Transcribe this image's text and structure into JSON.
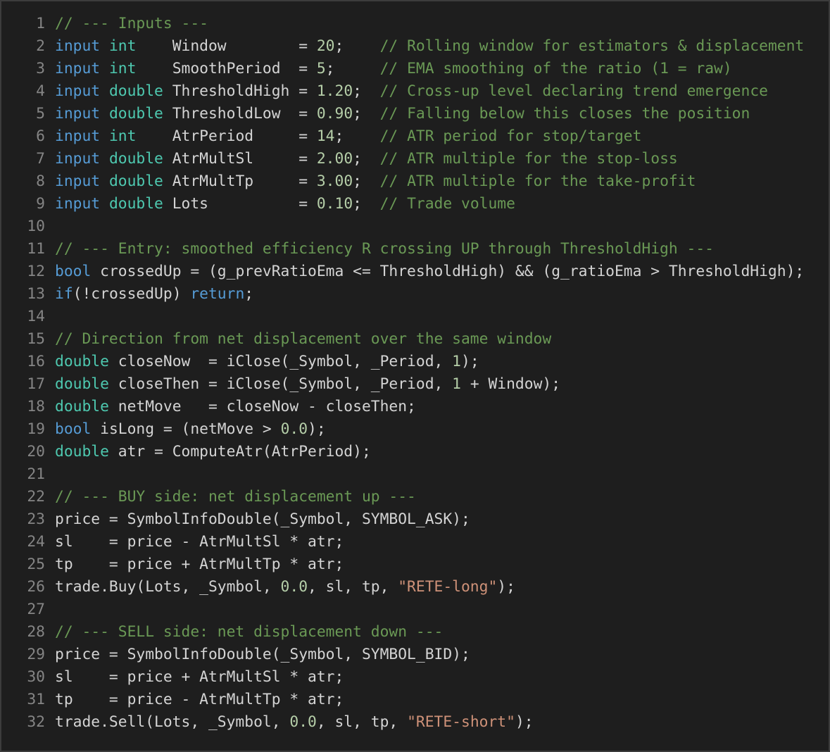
{
  "colors": {
    "background": "#1e1e1e",
    "border": "#3c3c3c",
    "line_number": "#858585",
    "plain": "#d4d4d4",
    "comment": "#6a9955",
    "keyword": "#569cd6",
    "type": "#4ec9b0",
    "number": "#b5cea8",
    "string": "#ce9178"
  },
  "editor": {
    "lines": [
      {
        "n": "1",
        "tokens": [
          {
            "t": "comment",
            "v": "// --- Inputs ---"
          }
        ]
      },
      {
        "n": "2",
        "tokens": [
          {
            "t": "keyword",
            "v": "input"
          },
          {
            "t": "plain",
            "v": " "
          },
          {
            "t": "type",
            "v": "int"
          },
          {
            "t": "plain",
            "v": "    Window        = "
          },
          {
            "t": "number",
            "v": "20"
          },
          {
            "t": "plain",
            "v": ";    "
          },
          {
            "t": "comment",
            "v": "// Rolling window for estimators & displacement"
          }
        ]
      },
      {
        "n": "3",
        "tokens": [
          {
            "t": "keyword",
            "v": "input"
          },
          {
            "t": "plain",
            "v": " "
          },
          {
            "t": "type",
            "v": "int"
          },
          {
            "t": "plain",
            "v": "    SmoothPeriod  = "
          },
          {
            "t": "number",
            "v": "5"
          },
          {
            "t": "plain",
            "v": ";     "
          },
          {
            "t": "comment",
            "v": "// EMA smoothing of the ratio (1 = raw)"
          }
        ]
      },
      {
        "n": "4",
        "tokens": [
          {
            "t": "keyword",
            "v": "input"
          },
          {
            "t": "plain",
            "v": " "
          },
          {
            "t": "type",
            "v": "double"
          },
          {
            "t": "plain",
            "v": " ThresholdHigh = "
          },
          {
            "t": "number",
            "v": "1.20"
          },
          {
            "t": "plain",
            "v": ";  "
          },
          {
            "t": "comment",
            "v": "// Cross-up level declaring trend emergence"
          }
        ]
      },
      {
        "n": "5",
        "tokens": [
          {
            "t": "keyword",
            "v": "input"
          },
          {
            "t": "plain",
            "v": " "
          },
          {
            "t": "type",
            "v": "double"
          },
          {
            "t": "plain",
            "v": " ThresholdLow  = "
          },
          {
            "t": "number",
            "v": "0.90"
          },
          {
            "t": "plain",
            "v": ";  "
          },
          {
            "t": "comment",
            "v": "// Falling below this closes the position"
          }
        ]
      },
      {
        "n": "6",
        "tokens": [
          {
            "t": "keyword",
            "v": "input"
          },
          {
            "t": "plain",
            "v": " "
          },
          {
            "t": "type",
            "v": "int"
          },
          {
            "t": "plain",
            "v": "    AtrPeriod     = "
          },
          {
            "t": "number",
            "v": "14"
          },
          {
            "t": "plain",
            "v": ";    "
          },
          {
            "t": "comment",
            "v": "// ATR period for stop/target"
          }
        ]
      },
      {
        "n": "7",
        "tokens": [
          {
            "t": "keyword",
            "v": "input"
          },
          {
            "t": "plain",
            "v": " "
          },
          {
            "t": "type",
            "v": "double"
          },
          {
            "t": "plain",
            "v": " AtrMultSl     = "
          },
          {
            "t": "number",
            "v": "2.00"
          },
          {
            "t": "plain",
            "v": ";  "
          },
          {
            "t": "comment",
            "v": "// ATR multiple for the stop-loss"
          }
        ]
      },
      {
        "n": "8",
        "tokens": [
          {
            "t": "keyword",
            "v": "input"
          },
          {
            "t": "plain",
            "v": " "
          },
          {
            "t": "type",
            "v": "double"
          },
          {
            "t": "plain",
            "v": " AtrMultTp     = "
          },
          {
            "t": "number",
            "v": "3.00"
          },
          {
            "t": "plain",
            "v": ";  "
          },
          {
            "t": "comment",
            "v": "// ATR multiple for the take-profit"
          }
        ]
      },
      {
        "n": "9",
        "tokens": [
          {
            "t": "keyword",
            "v": "input"
          },
          {
            "t": "plain",
            "v": " "
          },
          {
            "t": "type",
            "v": "double"
          },
          {
            "t": "plain",
            "v": " Lots          = "
          },
          {
            "t": "number",
            "v": "0.10"
          },
          {
            "t": "plain",
            "v": ";  "
          },
          {
            "t": "comment",
            "v": "// Trade volume"
          }
        ]
      },
      {
        "n": "10",
        "tokens": []
      },
      {
        "n": "11",
        "tokens": [
          {
            "t": "comment",
            "v": "// --- Entry: smoothed efficiency R crossing UP through ThresholdHigh ---"
          }
        ]
      },
      {
        "n": "12",
        "tokens": [
          {
            "t": "keyword",
            "v": "bool"
          },
          {
            "t": "plain",
            "v": " crossedUp = (g_prevRatioEma <= ThresholdHigh) && (g_ratioEma > ThresholdHigh);"
          }
        ]
      },
      {
        "n": "13",
        "tokens": [
          {
            "t": "keyword",
            "v": "if"
          },
          {
            "t": "plain",
            "v": "(!crossedUp) "
          },
          {
            "t": "keyword",
            "v": "return"
          },
          {
            "t": "plain",
            "v": ";"
          }
        ]
      },
      {
        "n": "14",
        "tokens": []
      },
      {
        "n": "15",
        "tokens": [
          {
            "t": "comment",
            "v": "// Direction from net displacement over the same window"
          }
        ]
      },
      {
        "n": "16",
        "tokens": [
          {
            "t": "type",
            "v": "double"
          },
          {
            "t": "plain",
            "v": " closeNow  = iClose(_Symbol, _Period, "
          },
          {
            "t": "number",
            "v": "1"
          },
          {
            "t": "plain",
            "v": ");"
          }
        ]
      },
      {
        "n": "17",
        "tokens": [
          {
            "t": "type",
            "v": "double"
          },
          {
            "t": "plain",
            "v": " closeThen = iClose(_Symbol, _Period, "
          },
          {
            "t": "number",
            "v": "1"
          },
          {
            "t": "plain",
            "v": " + Window);"
          }
        ]
      },
      {
        "n": "18",
        "tokens": [
          {
            "t": "type",
            "v": "double"
          },
          {
            "t": "plain",
            "v": " netMove   = closeNow - closeThen;"
          }
        ]
      },
      {
        "n": "19",
        "tokens": [
          {
            "t": "keyword",
            "v": "bool"
          },
          {
            "t": "plain",
            "v": " isLong = (netMove > "
          },
          {
            "t": "number",
            "v": "0.0"
          },
          {
            "t": "plain",
            "v": ");"
          }
        ]
      },
      {
        "n": "20",
        "tokens": [
          {
            "t": "type",
            "v": "double"
          },
          {
            "t": "plain",
            "v": " atr = ComputeAtr(AtrPeriod);"
          }
        ]
      },
      {
        "n": "21",
        "tokens": []
      },
      {
        "n": "22",
        "tokens": [
          {
            "t": "comment",
            "v": "// --- BUY side: net displacement up ---"
          }
        ]
      },
      {
        "n": "23",
        "tokens": [
          {
            "t": "plain",
            "v": "price = SymbolInfoDouble(_Symbol, SYMBOL_ASK);"
          }
        ]
      },
      {
        "n": "24",
        "tokens": [
          {
            "t": "plain",
            "v": "sl    = price - AtrMultSl * atr;"
          }
        ]
      },
      {
        "n": "25",
        "tokens": [
          {
            "t": "plain",
            "v": "tp    = price + AtrMultTp * atr;"
          }
        ]
      },
      {
        "n": "26",
        "tokens": [
          {
            "t": "plain",
            "v": "trade.Buy(Lots, _Symbol, "
          },
          {
            "t": "number",
            "v": "0.0"
          },
          {
            "t": "plain",
            "v": ", sl, tp, "
          },
          {
            "t": "string",
            "v": "\"RETE-long\""
          },
          {
            "t": "plain",
            "v": ");"
          }
        ]
      },
      {
        "n": "27",
        "tokens": []
      },
      {
        "n": "28",
        "tokens": [
          {
            "t": "comment",
            "v": "// --- SELL side: net displacement down ---"
          }
        ]
      },
      {
        "n": "29",
        "tokens": [
          {
            "t": "plain",
            "v": "price = SymbolInfoDouble(_Symbol, SYMBOL_BID);"
          }
        ]
      },
      {
        "n": "30",
        "tokens": [
          {
            "t": "plain",
            "v": "sl    = price + AtrMultSl * atr;"
          }
        ]
      },
      {
        "n": "31",
        "tokens": [
          {
            "t": "plain",
            "v": "tp    = price - AtrMultTp * atr;"
          }
        ]
      },
      {
        "n": "32",
        "tokens": [
          {
            "t": "plain",
            "v": "trade.Sell(Lots, _Symbol, "
          },
          {
            "t": "number",
            "v": "0.0"
          },
          {
            "t": "plain",
            "v": ", sl, tp, "
          },
          {
            "t": "string",
            "v": "\"RETE-short\""
          },
          {
            "t": "plain",
            "v": ");"
          }
        ]
      }
    ]
  }
}
